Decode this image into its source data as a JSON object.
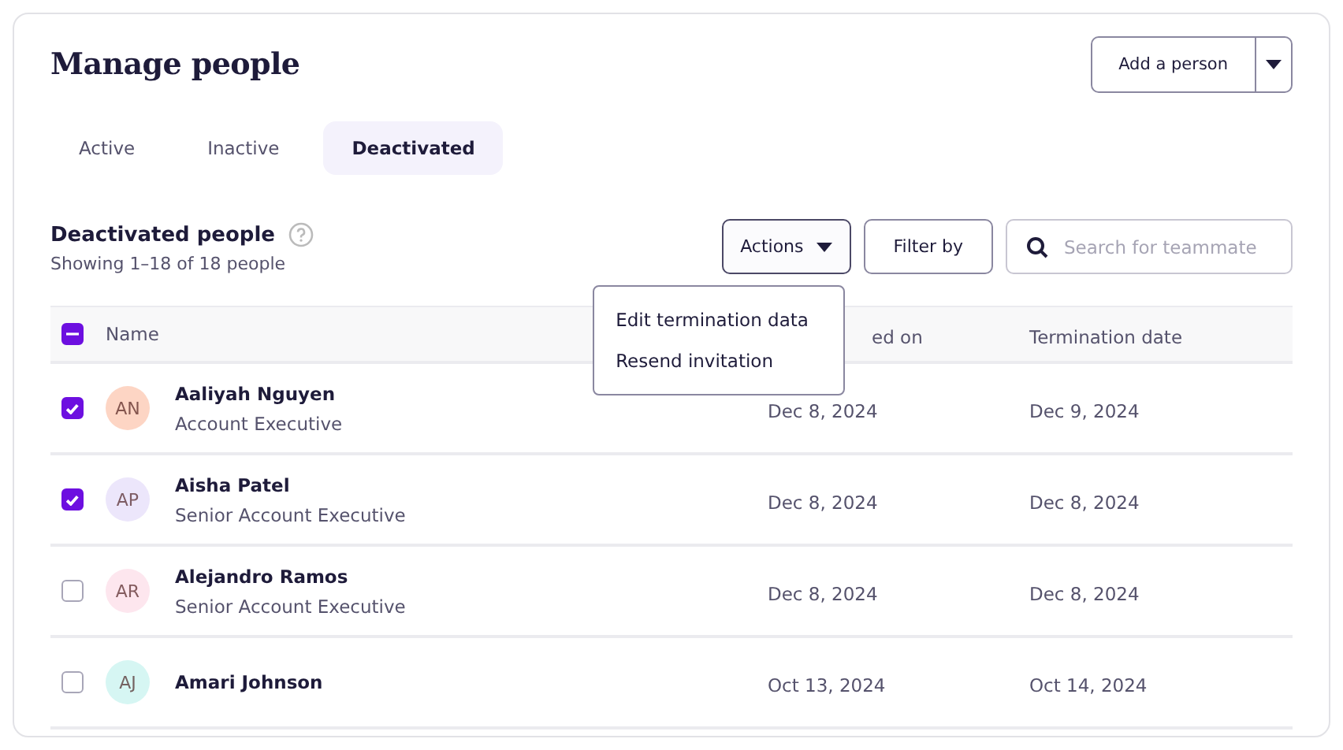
{
  "page": {
    "title": "Manage people",
    "add_button": "Add a person"
  },
  "tabs": [
    {
      "label": "Active",
      "selected": false
    },
    {
      "label": "Inactive",
      "selected": false
    },
    {
      "label": "Deactivated",
      "selected": true
    }
  ],
  "section": {
    "title": "Deactivated people",
    "subtitle": "Showing 1–18 of 18 people"
  },
  "toolbar": {
    "actions": "Actions",
    "filter": "Filter by",
    "search": {
      "placeholder": "Search for teammate"
    }
  },
  "actions_menu": {
    "expanded": true,
    "items": [
      "Edit termination data",
      "Resend invitation"
    ]
  },
  "table": {
    "select_all": {
      "indeterminate": true
    },
    "columns": [
      {
        "label": "Name"
      },
      {
        "label": "ed on"
      },
      {
        "label": "Termination date"
      }
    ],
    "rows": [
      {
        "checked": true,
        "initials": "AN",
        "color": "#fdd5c4",
        "name": "Aaliyah Nguyen",
        "role": "Account Executive",
        "column_2": "Dec 8, 2024",
        "termination_date": "Dec 9, 2024"
      },
      {
        "checked": true,
        "initials": "AP",
        "color": "#ece6fb",
        "name": "Aisha Patel",
        "role": "Senior Account Executive",
        "column_2": "Dec 8, 2024",
        "termination_date": "Dec 8, 2024"
      },
      {
        "checked": false,
        "initials": "AR",
        "color": "#fde6ee",
        "name": "Alejandro Ramos",
        "role": "Senior Account Executive",
        "column_2": "Dec 8, 2024",
        "termination_date": "Dec 8, 2024"
      },
      {
        "checked": false,
        "initials": "AJ",
        "color": "#d6f6f3",
        "name": "Amari Johnson",
        "column_2": "Oct 13, 2024",
        "termination_date": "Oct 14, 2024"
      }
    ]
  }
}
